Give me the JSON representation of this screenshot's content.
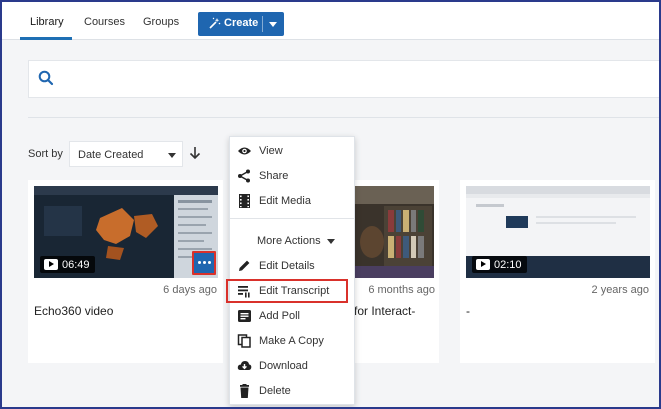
{
  "nav": {
    "tabs": [
      {
        "label": "Library",
        "active": true
      },
      {
        "label": "Courses",
        "active": false
      },
      {
        "label": "Groups",
        "active": false
      }
    ],
    "create_label": "Create"
  },
  "search": {
    "placeholder": ""
  },
  "sort": {
    "label": "Sort by",
    "selected": "Date Created",
    "direction": "descending"
  },
  "cards": [
    {
      "duration": "06:49",
      "age": "6 days ago",
      "title": "Echo360 video"
    },
    {
      "duration": "",
      "age": "6 months ago",
      "title": "o for Interact-"
    },
    {
      "duration": "02:10",
      "age": "2 years ago",
      "title": "-"
    }
  ],
  "menu": {
    "items_top": [
      "View",
      "Share",
      "Edit Media"
    ],
    "more_actions_label": "More Actions",
    "items_bottom": [
      "Edit Details",
      "Edit Transcript",
      "Add Poll",
      "Make A Copy",
      "Download",
      "Delete"
    ],
    "highlighted": "Edit Transcript"
  },
  "colors": {
    "accent": "#1f66b0",
    "highlight": "#d9312b",
    "frame": "#2a3a8c"
  }
}
